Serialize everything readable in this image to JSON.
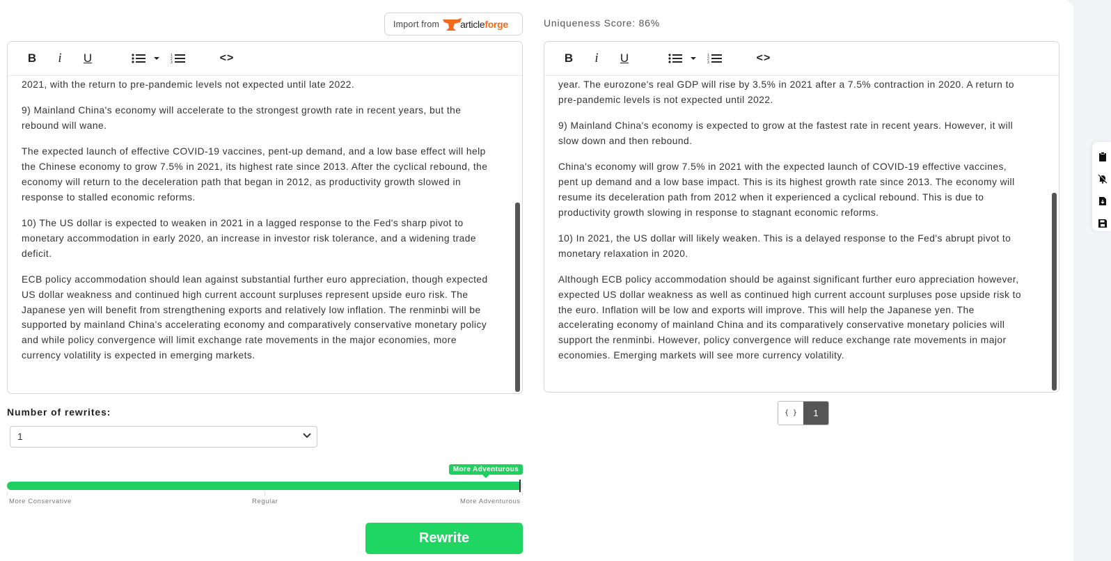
{
  "import": {
    "label": "Import from",
    "brand_prefix": "article",
    "brand_suffix": "forge"
  },
  "uniqueness": {
    "text": "Uniqueness Score: 86%"
  },
  "toolbar": {
    "bold": "B",
    "italic": "i",
    "underline": "U",
    "code": "<>"
  },
  "left_editor": {
    "paragraphs": [
      "2021, with the return to pre-pandemic levels not expected until late 2022.",
      "9) Mainland China's economy will accelerate to the strongest growth rate in recent years, but the rebound will wane.",
      "The expected launch of effective COVID-19 vaccines, pent-up demand, and a low base effect will help the Chinese economy to grow 7.5% in 2021, its highest rate since 2013. After the cyclical rebound, the economy will return to the deceleration path that began in 2012, as productivity growth slowed in response to stalled economic reforms.",
      "10) The US dollar is expected to weaken in 2021 in a lagged response to the Fed's sharp pivot to monetary accommodation in early 2020, an increase in investor risk tolerance, and a widening trade deficit.",
      "ECB policy accommodation should lean against substantial further euro appreciation, though expected US dollar weakness and continued high current account surpluses represent upside euro risk. The Japanese yen will benefit from strengthening exports and relatively low inflation. The renminbi will be supported by mainland China's accelerating economy and comparatively conservative monetary policy and while policy convergence will limit exchange rate movements in the major economies, more currency volatility is expected in emerging markets."
    ]
  },
  "right_editor": {
    "paragraphs": [
      "year. The eurozone's real GDP will rise by 3.5% in 2021 after a 7.5% contraction in 2020. A return to pre-pandemic levels is not expected until 2022.",
      "9) Mainland China's economy is expected to grow at the fastest rate in recent years. However, it will slow down and then rebound.",
      "China's economy will grow 7.5% in 2021 with the expected launch of COVID-19 effective vaccines, pent up demand and a low base impact. This is its highest growth rate since 2013. The economy will resume its deceleration path from 2012 when it experienced a cyclical rebound. This is due to productivity growth slowing in response to stagnant economic reforms.",
      "10) In 2021, the US dollar will likely weaken. This is a delayed response to the Fed's abrupt pivot to monetary relaxation in 2020.",
      "Although ECB policy accommodation should be against significant further euro appreciation however, expected US dollar weakness as well as continued high current account surpluses pose upside risk to the euro. Inflation will be low and exports will improve. This will help the Japanese yen. The accelerating economy of mainland China and its comparatively conservative monetary policies will support the renminbi. However, policy convergence will reduce exchange rate movements in major economies. Emerging markets will see more currency volatility."
    ]
  },
  "rewrites": {
    "label": "Number of rewrites:",
    "selected": "1"
  },
  "slider": {
    "tag": "More Adventurous",
    "value_fraction": 0.995,
    "labels": {
      "left": "More Conservative",
      "middle": "Regular",
      "right": "More Adventurous"
    }
  },
  "rewrite_button": {
    "label": "Rewrite"
  },
  "pager": {
    "code_label": "{ }",
    "page": "1"
  },
  "colors": {
    "accent_green": "#1fd662",
    "brand_orange": "#f26a1b"
  },
  "float_tools": [
    "clipboard-icon",
    "bell-off-icon",
    "download-file-icon",
    "save-icon"
  ]
}
